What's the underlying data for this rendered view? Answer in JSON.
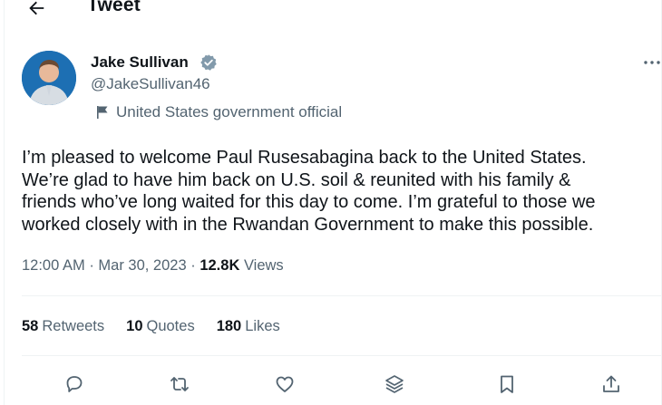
{
  "header": {
    "title": "Tweet"
  },
  "author": {
    "name": "Jake Sullivan",
    "handle": "@JakeSullivan46",
    "label": "United States government official"
  },
  "tweet": {
    "text": "I’m pleased to welcome Paul Rusesabagina back to the United States.\nWe’re glad to have him back on U.S. soil & reunited with his family &\nfriends who’ve long waited for this day to come. I’m grateful to those we\nworked closely with in the Rwandan Government to make this possible."
  },
  "meta": {
    "time": "12:00 AM",
    "separator": "·",
    "date": "Mar 30, 2023",
    "views_count": "12.8K",
    "views_label": "Views"
  },
  "stats": {
    "retweets_count": "58",
    "retweets_label": "Retweets",
    "quotes_count": "10",
    "quotes_label": "Quotes",
    "likes_count": "180",
    "likes_label": "Likes"
  },
  "colors": {
    "text_primary": "#0f1419",
    "text_secondary": "#536471",
    "divider": "#eff3f4",
    "avatar_bg": "#1d6fb3",
    "verified_badge": "#829aab"
  },
  "icons": {
    "back": "arrow-left-icon",
    "verified": "verified-badge-icon",
    "more": "more-horizontal-icon",
    "gov": "flag-icon",
    "reply": "reply-icon",
    "retweet": "retweet-icon",
    "like": "heart-icon",
    "bookmark_stack": "layers-icon",
    "bookmark": "bookmark-icon",
    "share": "share-icon"
  }
}
